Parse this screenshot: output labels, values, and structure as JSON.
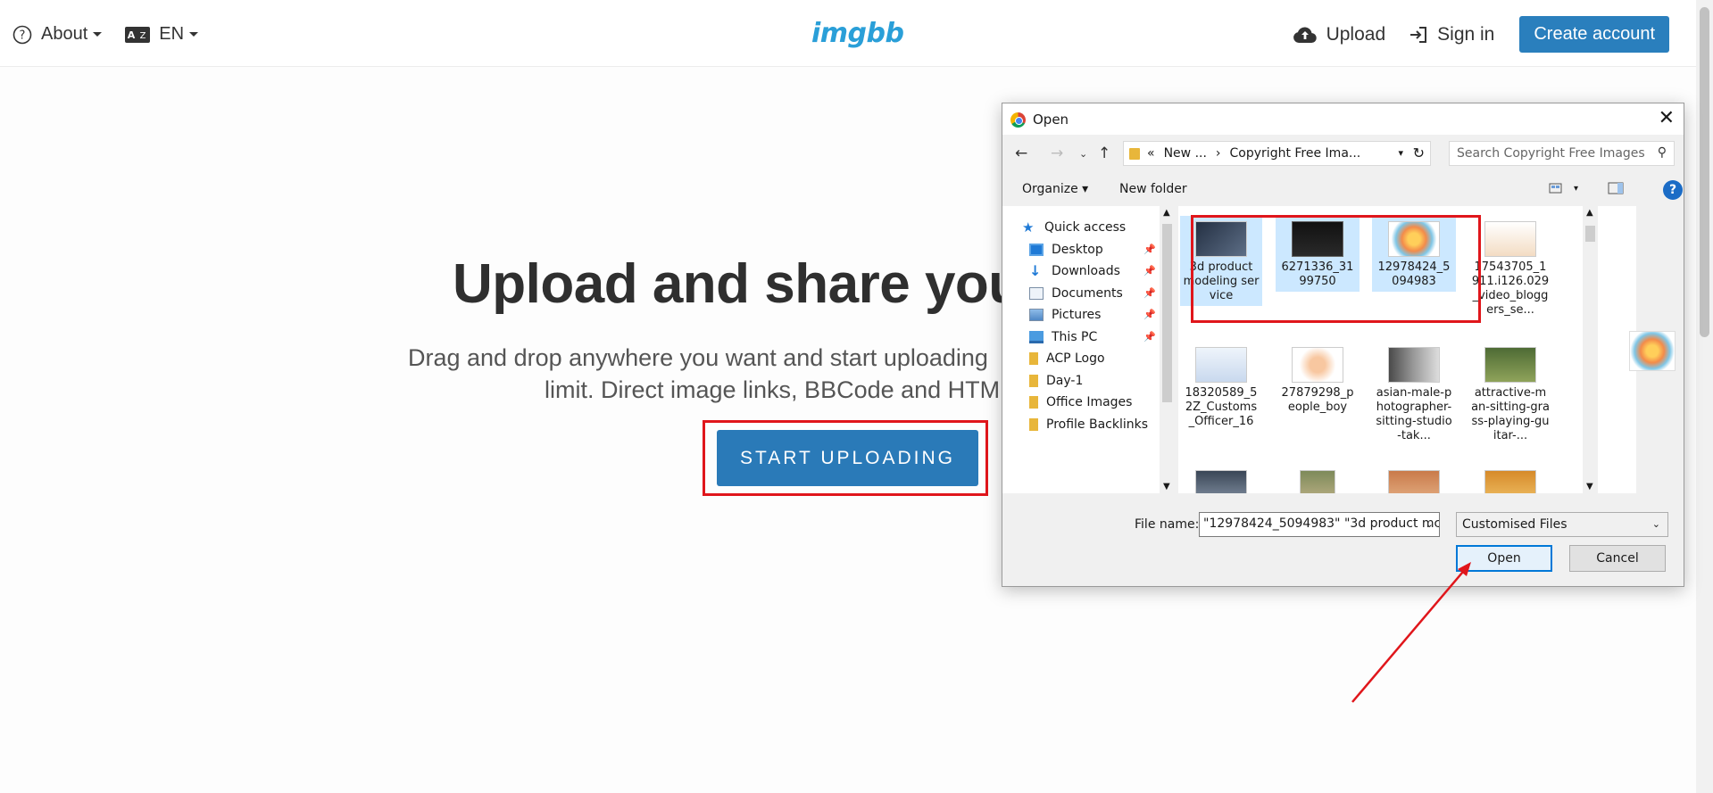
{
  "nav": {
    "about_label": "About",
    "lang_label": "EN",
    "logo_text": "imgbb",
    "upload_label": "Upload",
    "signin_label": "Sign in",
    "create_account_label": "Create account"
  },
  "hero": {
    "title": "Upload and share you",
    "subtitle_line1": "Drag and drop anywhere you want and start uploading",
    "subtitle_line2": "limit. Direct image links, BBCode and HTM",
    "start_button": "START UPLOADING"
  },
  "dialog": {
    "title": "Open",
    "breadcrumb": [
      "«",
      "New ...",
      "›",
      "Copyright Free Ima..."
    ],
    "search_placeholder": "Search Copyright Free Images",
    "organize_label": "Organize",
    "new_folder_label": "New folder",
    "help_label": "?",
    "nav_items": [
      {
        "label": "Quick access",
        "icon": "star-icon",
        "pinned": false
      },
      {
        "label": "Desktop",
        "icon": "desktop-icon",
        "pinned": true
      },
      {
        "label": "Downloads",
        "icon": "download-icon",
        "pinned": true
      },
      {
        "label": "Documents",
        "icon": "documents-icon",
        "pinned": true
      },
      {
        "label": "Pictures",
        "icon": "pictures-icon",
        "pinned": true
      },
      {
        "label": "This PC",
        "icon": "pc-icon",
        "pinned": true
      },
      {
        "label": "ACP Logo",
        "icon": "folder-icon",
        "pinned": false
      },
      {
        "label": "Day-1",
        "icon": "folder-icon",
        "pinned": false
      },
      {
        "label": "Office Images",
        "icon": "folder-icon",
        "pinned": false
      },
      {
        "label": "Profile Backlinks",
        "icon": "folder-icon",
        "pinned": false
      }
    ],
    "files": [
      {
        "label": "3d product modeling service",
        "selected": true
      },
      {
        "label": "6271336_3199750",
        "selected": true
      },
      {
        "label": "12978424_5094983",
        "selected": true
      },
      {
        "label": "17543705_1911.i126.029_video_bloggers_se...",
        "selected": false
      },
      {
        "label": "18320589_52Z_Customs_Officer_16",
        "selected": false
      },
      {
        "label": "27879298_people_boy",
        "selected": false
      },
      {
        "label": "asian-male-photographer-sitting-studio-tak...",
        "selected": false
      },
      {
        "label": "attractive-man-sitting-grass-playing-guitar-...",
        "selected": false
      }
    ],
    "file_name_label": "File name:",
    "file_name_value": "\"12978424_5094983\" \"3d product mc",
    "file_type_value": "Customised Files",
    "open_button": "Open",
    "cancel_button": "Cancel"
  },
  "colors": {
    "brand": "#2a9fd8",
    "primary_button": "#2a7ab8",
    "highlight": "#e0161b",
    "selection": "#cce8ff"
  }
}
